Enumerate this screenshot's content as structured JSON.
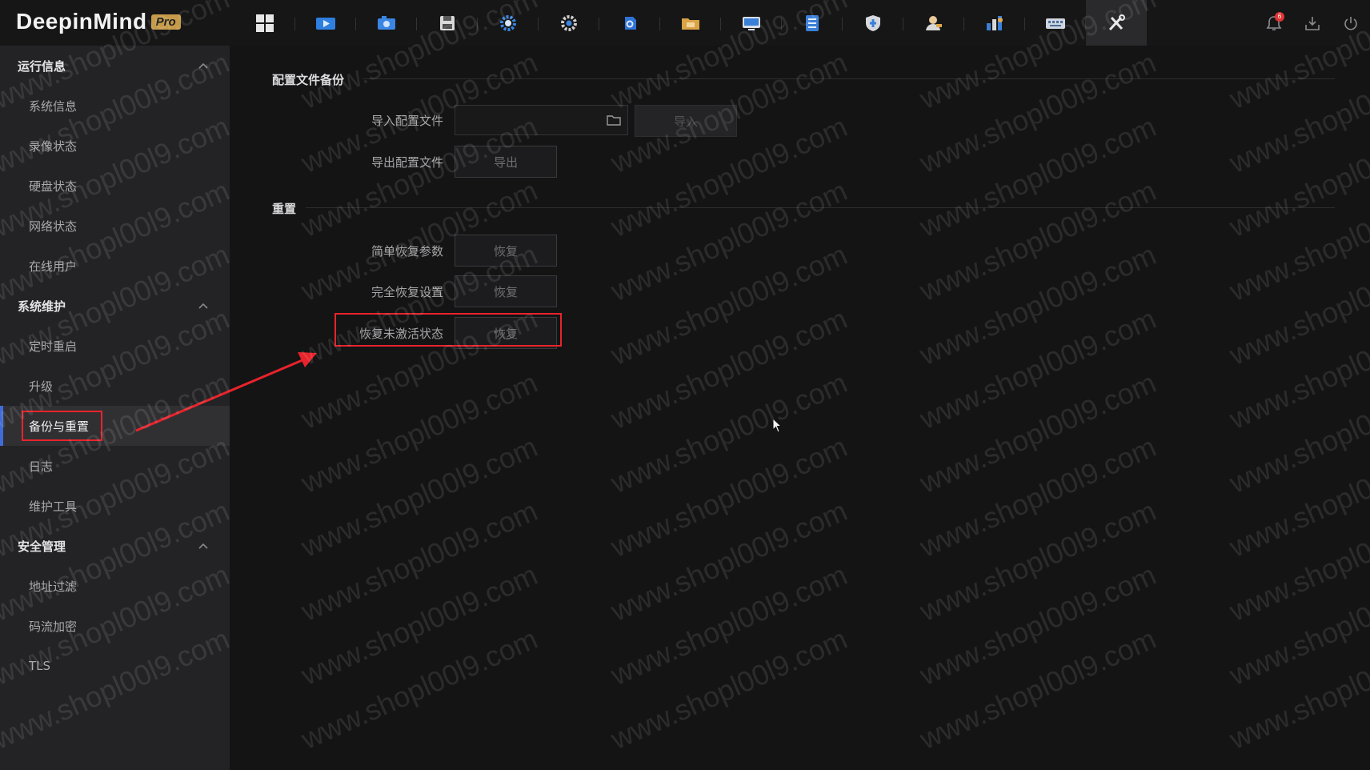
{
  "app": {
    "brand": "DeepinMind",
    "edition": "Pro"
  },
  "topnav": {
    "icons": [
      "grid-view-icon",
      "live-view-icon",
      "playback-icon",
      "storage-icon",
      "settings-icon",
      "advanced-settings-icon",
      "smart-search-icon",
      "file-folder-icon",
      "network-monitor-icon",
      "list-icon",
      "security-shield-icon",
      "user-icon",
      "statistics-icon",
      "keyboard-icon",
      "maintenance-tools-icon"
    ],
    "active_index": 14,
    "right_icons": [
      "notification-bell-icon",
      "download-icon",
      "power-icon"
    ],
    "notification_count": "6"
  },
  "sidebar": {
    "groups": [
      {
        "title": "运行信息",
        "items": [
          "系统信息",
          "录像状态",
          "硬盘状态",
          "网络状态",
          "在线用户"
        ]
      },
      {
        "title": "系统维护",
        "items": [
          "定时重启",
          "升级",
          "备份与重置",
          "日志",
          "维护工具"
        ]
      },
      {
        "title": "安全管理",
        "items": [
          "地址过滤",
          "码流加密",
          "TLS"
        ]
      }
    ],
    "active_item": "备份与重置"
  },
  "main": {
    "backup": {
      "title": "配置文件备份",
      "import_label": "导入配置文件",
      "import_value": "",
      "import_button": "导入",
      "export_label": "导出配置文件",
      "export_button": "导出"
    },
    "reset": {
      "title": "重置",
      "simple_label": "简单恢复参数",
      "simple_button": "恢复",
      "full_label": "完全恢复设置",
      "full_button": "恢复",
      "inactive_label": "恢复未激活状态",
      "inactive_button": "恢复"
    }
  },
  "annotation": {
    "highlight_color": "#e8232b"
  },
  "watermark_text": "www.shopl00l9.com"
}
